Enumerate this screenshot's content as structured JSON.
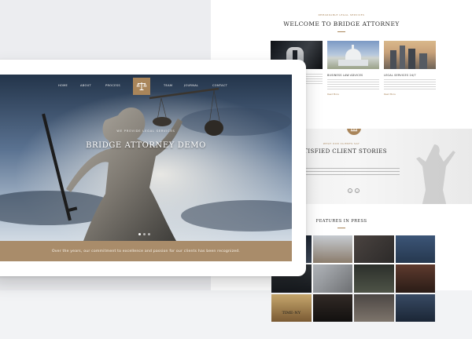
{
  "colors": {
    "accent": "#a9855a",
    "strip": "#a98c6a",
    "sky_top": "#23344a",
    "sky_bottom": "#d2dbe4"
  },
  "back_page": {
    "welcome_eyebrow": "REMARKABLE LEGAL SERVICES",
    "welcome_title": "WELCOME TO BRIDGE ATTORNEY",
    "services": [
      {
        "label": "",
        "more": "Read More"
      },
      {
        "label": "BUSINESS LAW ADVICES",
        "more": "Read More"
      },
      {
        "label": "LEGAL SERVICES 24/7",
        "more": "Read More"
      }
    ],
    "testimonials_eyebrow": "WHAT OUR CLIENTS SAY",
    "testimonials_title": "SATISFIED CLIENT STORIES",
    "badge_icon": "courthouse-icon",
    "press_title": "FEATURES IN PRESS",
    "press_tiles": [
      "",
      "",
      "",
      "",
      "",
      "",
      "",
      "",
      "TIME-NY",
      "",
      "",
      ""
    ]
  },
  "hero": {
    "nav_left": [
      "HOME",
      "ABOUT",
      "PROCESS"
    ],
    "nav_right": [
      "TEAM",
      "JOURNAL",
      "CONTACT"
    ],
    "logo_icon": "scales-of-justice-icon",
    "subtitle": "WE PROVIDE LEGAL SERVICES",
    "title": "BRIDGE ATTORNEY DEMO",
    "strip_text": "Over the years, our commitment to excellence and passion for our clients has been recognized."
  }
}
